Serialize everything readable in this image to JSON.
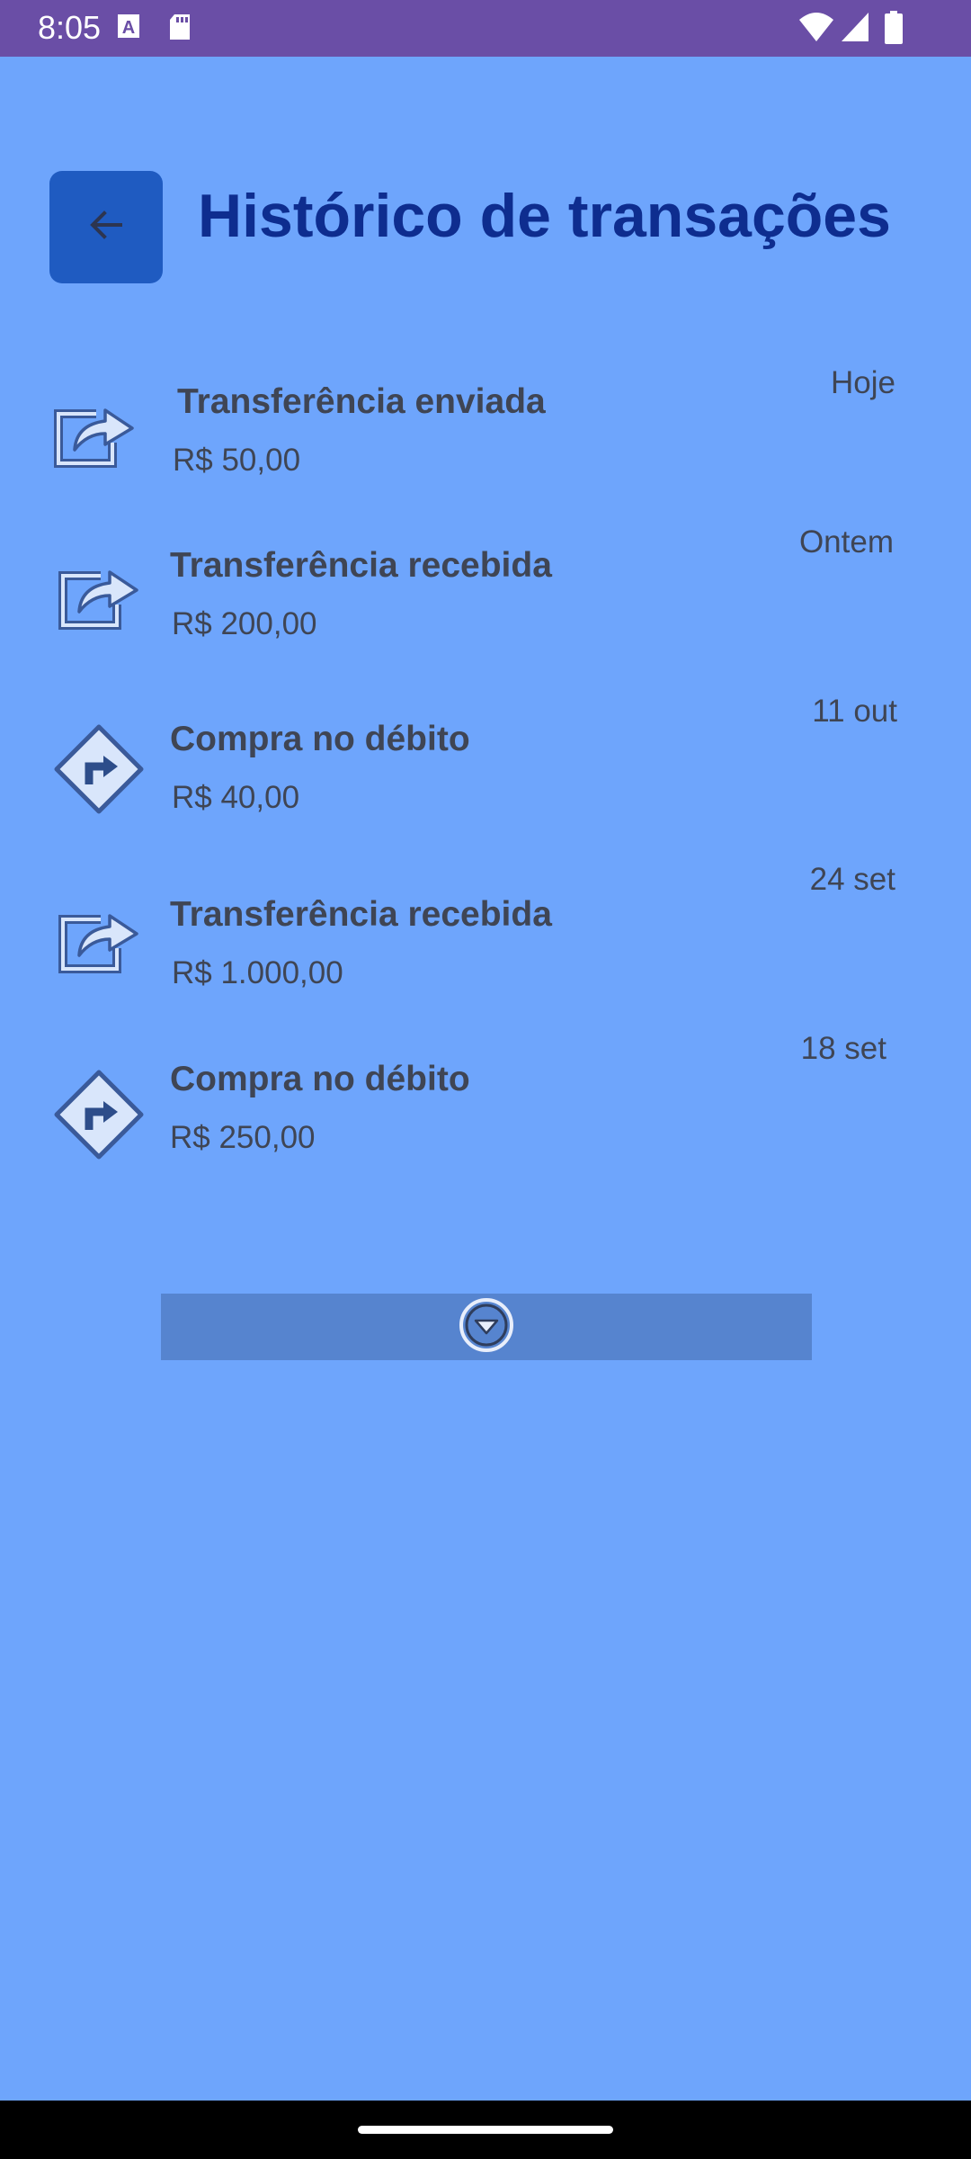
{
  "status_bar": {
    "time": "8:05",
    "left_icons": [
      "text-a-icon",
      "sd-card-icon"
    ],
    "right_icons": [
      "wifi-icon",
      "signal-icon",
      "battery-icon"
    ],
    "background": "#6a4ea6"
  },
  "header": {
    "title": "Histórico de transações",
    "back_icon": "arrow-left-icon"
  },
  "transactions": [
    {
      "title": "Transferência enviada",
      "amount": "R$ 50,00",
      "date": "Hoje",
      "icon": "share-arrow-icon"
    },
    {
      "title": "Transferência recebida",
      "amount": "R$ 200,00",
      "date": "Ontem",
      "icon": "share-arrow-icon"
    },
    {
      "title": "Compra no débito",
      "amount": "R$ 40,00",
      "date": "11 out",
      "icon": "turn-right-sign-icon"
    },
    {
      "title": "Transferência recebida",
      "amount": "R$ 1.000,00",
      "date": "24 set",
      "icon": "share-arrow-icon"
    },
    {
      "title": "Compra no débito",
      "amount": "R$ 250,00",
      "date": "18 set",
      "icon": "turn-right-sign-icon"
    }
  ],
  "load_more": {
    "icon": "chevron-circle-down-icon"
  },
  "colors": {
    "background": "#6ea5fc",
    "title": "#0e2d8f",
    "back_button": "#1f5bc1",
    "text": "#3f4554",
    "load_more": "#5684cf"
  }
}
